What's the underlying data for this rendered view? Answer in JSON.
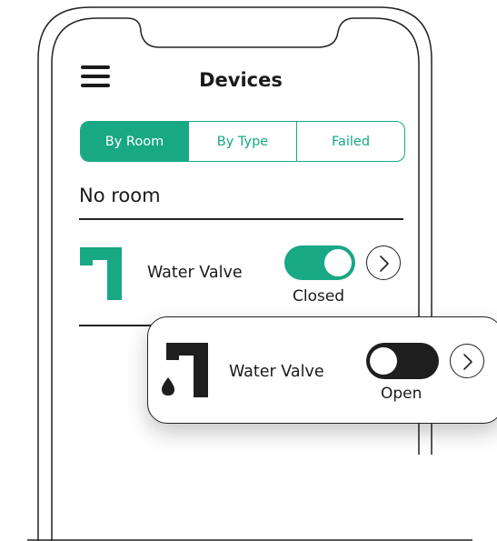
{
  "header": {
    "title": "Devices",
    "menu_icon": "hamburger-menu-icon"
  },
  "tabs": [
    {
      "label": "By Room",
      "active": true
    },
    {
      "label": "By Type",
      "active": false
    },
    {
      "label": "Failed",
      "active": false
    }
  ],
  "section": {
    "title": "No room"
  },
  "device_row": {
    "name": "Water Valve",
    "status": "Closed",
    "toggle_on": true,
    "icon": "water-valve-icon",
    "chevron_icon": "chevron-right-icon"
  },
  "popup_card": {
    "name": "Water Valve",
    "status": "Open",
    "toggle_on": false,
    "icon": "water-valve-dripping-icon",
    "chevron_icon": "chevron-right-icon"
  },
  "colors": {
    "accent": "#18a883",
    "dark": "#1e1e1e",
    "background": "#ffffff"
  }
}
